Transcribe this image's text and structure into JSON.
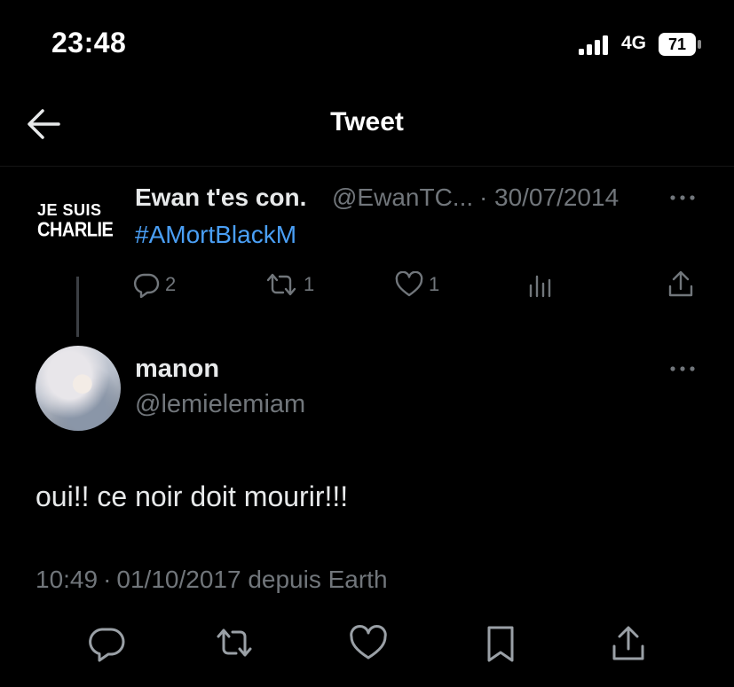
{
  "status_bar": {
    "time": "23:48",
    "network": "4G",
    "battery": "71"
  },
  "header": {
    "back_icon": "arrow-left-icon",
    "title": "Tweet"
  },
  "parent_tweet": {
    "avatar_text_line1": "JE SUIS",
    "avatar_text_line2": "CHARLIE",
    "display_name": "Ewan t'es con.",
    "handle": "@EwanTC...",
    "separator": "·",
    "date": "30/07/2014",
    "text": "#AMortBlackM",
    "replies": "2",
    "retweets": "1",
    "likes": "1"
  },
  "main_tweet": {
    "display_name": "manon",
    "handle": "@lemielemiam",
    "text": "oui!! ce noir doit mourir!!!",
    "time": "10:49",
    "separator": "·",
    "date_source": "01/10/2017 depuis Earth"
  },
  "colors": {
    "background": "#000000",
    "text_primary": "#e7e9ea",
    "text_secondary": "#71767b",
    "link": "#4a9ff5"
  },
  "icons": [
    "reply-icon",
    "retweet-icon",
    "like-icon",
    "views-icon",
    "share-icon",
    "bookmark-icon",
    "more-icon"
  ]
}
